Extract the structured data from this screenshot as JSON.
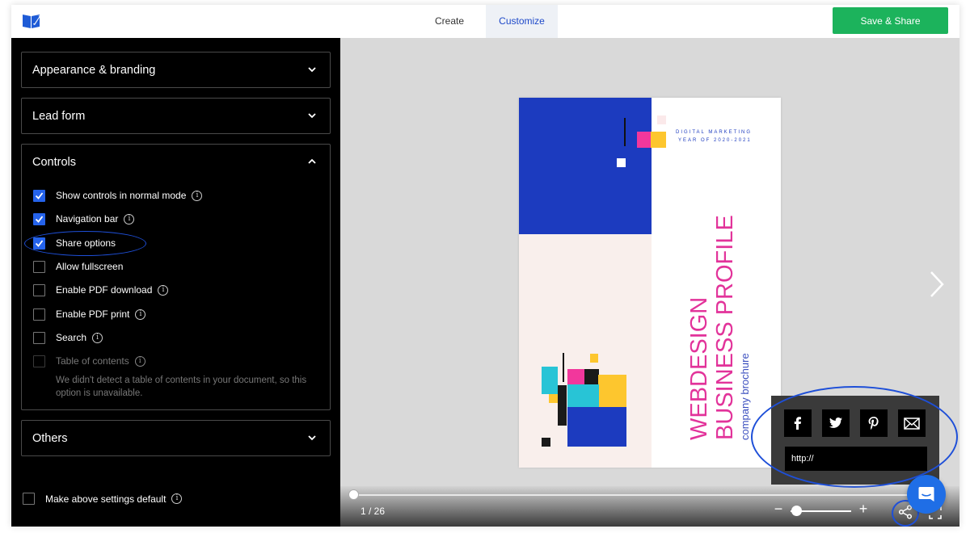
{
  "header": {
    "tabs": [
      {
        "label": "Create"
      },
      {
        "label": "Customize",
        "active": true
      }
    ],
    "save_label": "Save & Share",
    "colors": {
      "accent": "#1e49c9",
      "save": "#1cb35c"
    }
  },
  "sidebar": {
    "sections": [
      {
        "label": "Appearance & branding",
        "expanded": false
      },
      {
        "label": "Lead form",
        "expanded": false
      },
      {
        "label": "Controls",
        "expanded": true
      },
      {
        "label": "Others",
        "expanded": false
      }
    ],
    "controls": [
      {
        "label": "Show controls in normal mode",
        "checked": true
      },
      {
        "label": "Navigation bar",
        "checked": true
      },
      {
        "label": "Share options",
        "checked": true
      },
      {
        "label": "Allow fullscreen",
        "checked": false
      },
      {
        "label": "Enable PDF download",
        "checked": false
      },
      {
        "label": "Enable PDF print",
        "checked": false
      },
      {
        "label": "Search",
        "checked": false
      },
      {
        "label": "Table of contents",
        "checked": false,
        "disabled": true
      }
    ],
    "toc_note": "We didn't detect a table of contents in your document, so this option is unavailable.",
    "default_label": "Make above settings default"
  },
  "preview": {
    "document": {
      "small_heading_line1": "DIGITAL MARKETING",
      "small_heading_line2": "YEAR OF 2020-2021",
      "title_line1": "WEBDESIGN",
      "title_line2": "BUSINESS PROFILE",
      "subtitle": "company brochure"
    },
    "share": {
      "icons": [
        "facebook-icon",
        "twitter-icon",
        "pinterest-icon",
        "email-icon"
      ],
      "url_value": "http://"
    },
    "page_indicator": "1 / 26",
    "progress_fraction": 0.0,
    "zoom_minus": "−",
    "zoom_plus": "+",
    "zoom_fraction": 0.0
  }
}
